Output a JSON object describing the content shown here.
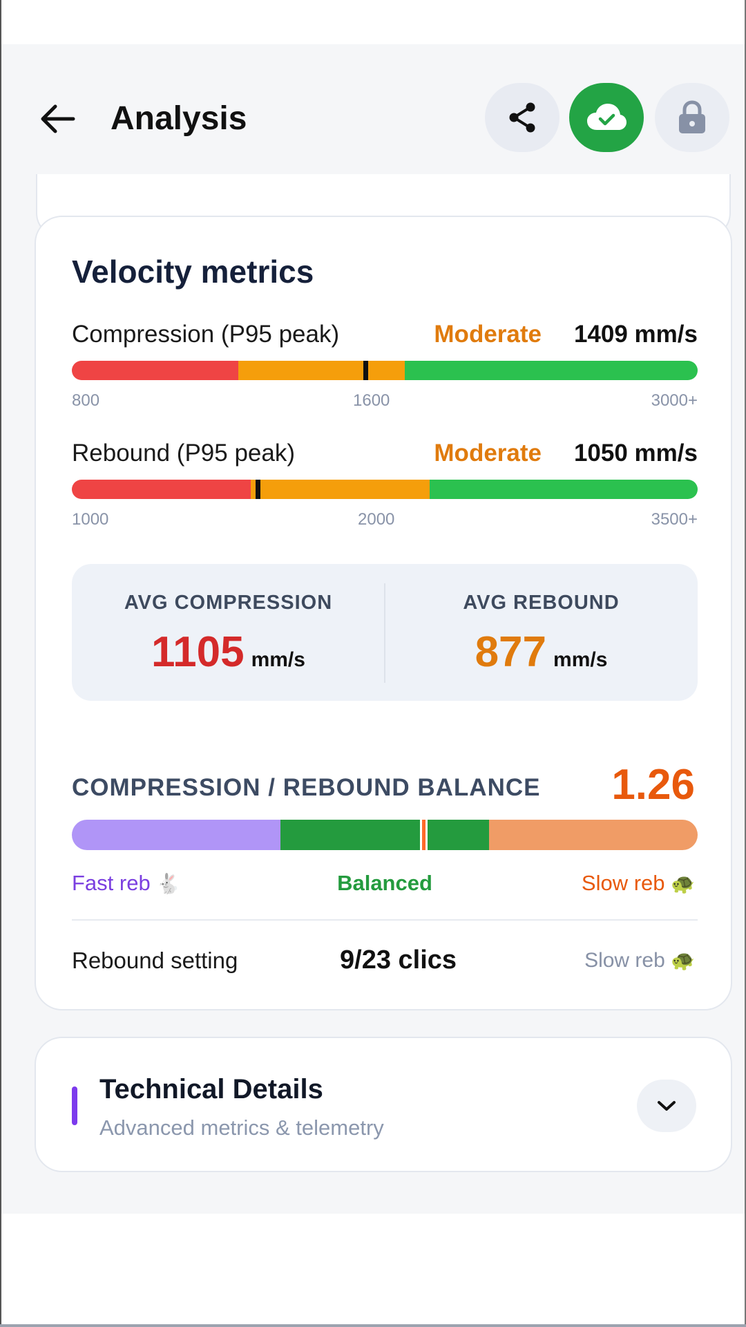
{
  "header": {
    "title": "Analysis",
    "back_icon": "arrow-left-icon",
    "actions": [
      {
        "name": "share",
        "icon": "share-icon"
      },
      {
        "name": "cloud-synced",
        "icon": "cloud-check-icon",
        "color": "#23a445"
      },
      {
        "name": "lock",
        "icon": "lock-icon"
      }
    ]
  },
  "velocity": {
    "title": "Velocity metrics",
    "compression": {
      "label": "Compression (P95 peak)",
      "level": "Moderate",
      "value": "1409 mm/s",
      "ticks": [
        "800",
        "1600",
        "3000+"
      ],
      "level_color": "#e07b0d"
    },
    "rebound": {
      "label": "Rebound (P95 peak)",
      "level": "Moderate",
      "value": "1050 mm/s",
      "ticks": [
        "1000",
        "2000",
        "3500+"
      ],
      "level_color": "#e07b0d"
    },
    "zone_colors": {
      "low": "#ef4444",
      "mid": "#f59e0b",
      "high": "#2bc14f"
    }
  },
  "averages": {
    "compression": {
      "label": "AVG COMPRESSION",
      "value": "1105",
      "unit": "mm/s",
      "color": "#d42a2a"
    },
    "rebound": {
      "label": "AVG REBOUND",
      "value": "877",
      "unit": "mm/s",
      "color": "#e07b0d"
    }
  },
  "balance": {
    "title": "COMPRESSION / REBOUND BALANCE",
    "value": "1.26",
    "labels": {
      "fast": "Fast reb",
      "mid": "Balanced",
      "slow": "Slow reb"
    },
    "fast_emoji": "🐇",
    "slow_emoji": "🐢"
  },
  "rebound_setting": {
    "label": "Rebound setting",
    "value": "9/23 clics",
    "tag": "Slow reb",
    "tag_emoji": "🐢"
  },
  "technical": {
    "title": "Technical Details",
    "subtitle": "Advanced metrics & telemetry",
    "expand_icon": "chevron-down-icon"
  }
}
